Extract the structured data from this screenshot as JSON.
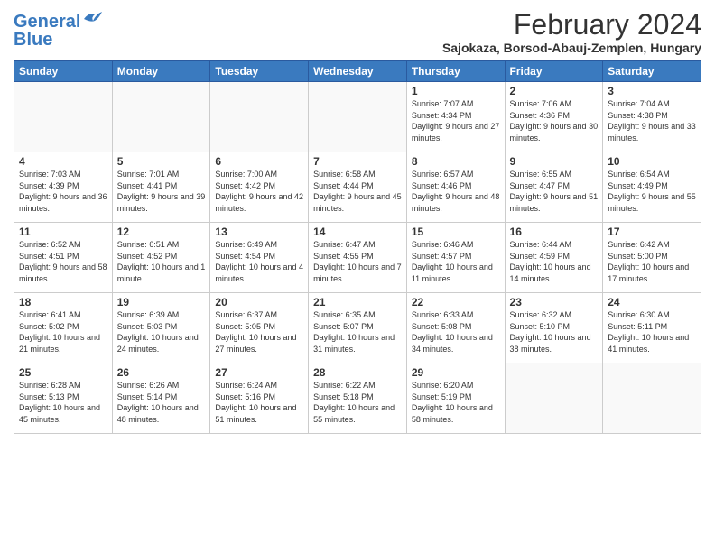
{
  "logo": {
    "line1": "General",
    "line2": "Blue"
  },
  "title": "February 2024",
  "subtitle": "Sajokaza, Borsod-Abauj-Zemplen, Hungary",
  "headers": [
    "Sunday",
    "Monday",
    "Tuesday",
    "Wednesday",
    "Thursday",
    "Friday",
    "Saturday"
  ],
  "weeks": [
    [
      {
        "day": "",
        "info": ""
      },
      {
        "day": "",
        "info": ""
      },
      {
        "day": "",
        "info": ""
      },
      {
        "day": "",
        "info": ""
      },
      {
        "day": "1",
        "info": "Sunrise: 7:07 AM\nSunset: 4:34 PM\nDaylight: 9 hours and 27 minutes."
      },
      {
        "day": "2",
        "info": "Sunrise: 7:06 AM\nSunset: 4:36 PM\nDaylight: 9 hours and 30 minutes."
      },
      {
        "day": "3",
        "info": "Sunrise: 7:04 AM\nSunset: 4:38 PM\nDaylight: 9 hours and 33 minutes."
      }
    ],
    [
      {
        "day": "4",
        "info": "Sunrise: 7:03 AM\nSunset: 4:39 PM\nDaylight: 9 hours and 36 minutes."
      },
      {
        "day": "5",
        "info": "Sunrise: 7:01 AM\nSunset: 4:41 PM\nDaylight: 9 hours and 39 minutes."
      },
      {
        "day": "6",
        "info": "Sunrise: 7:00 AM\nSunset: 4:42 PM\nDaylight: 9 hours and 42 minutes."
      },
      {
        "day": "7",
        "info": "Sunrise: 6:58 AM\nSunset: 4:44 PM\nDaylight: 9 hours and 45 minutes."
      },
      {
        "day": "8",
        "info": "Sunrise: 6:57 AM\nSunset: 4:46 PM\nDaylight: 9 hours and 48 minutes."
      },
      {
        "day": "9",
        "info": "Sunrise: 6:55 AM\nSunset: 4:47 PM\nDaylight: 9 hours and 51 minutes."
      },
      {
        "day": "10",
        "info": "Sunrise: 6:54 AM\nSunset: 4:49 PM\nDaylight: 9 hours and 55 minutes."
      }
    ],
    [
      {
        "day": "11",
        "info": "Sunrise: 6:52 AM\nSunset: 4:51 PM\nDaylight: 9 hours and 58 minutes."
      },
      {
        "day": "12",
        "info": "Sunrise: 6:51 AM\nSunset: 4:52 PM\nDaylight: 10 hours and 1 minute."
      },
      {
        "day": "13",
        "info": "Sunrise: 6:49 AM\nSunset: 4:54 PM\nDaylight: 10 hours and 4 minutes."
      },
      {
        "day": "14",
        "info": "Sunrise: 6:47 AM\nSunset: 4:55 PM\nDaylight: 10 hours and 7 minutes."
      },
      {
        "day": "15",
        "info": "Sunrise: 6:46 AM\nSunset: 4:57 PM\nDaylight: 10 hours and 11 minutes."
      },
      {
        "day": "16",
        "info": "Sunrise: 6:44 AM\nSunset: 4:59 PM\nDaylight: 10 hours and 14 minutes."
      },
      {
        "day": "17",
        "info": "Sunrise: 6:42 AM\nSunset: 5:00 PM\nDaylight: 10 hours and 17 minutes."
      }
    ],
    [
      {
        "day": "18",
        "info": "Sunrise: 6:41 AM\nSunset: 5:02 PM\nDaylight: 10 hours and 21 minutes."
      },
      {
        "day": "19",
        "info": "Sunrise: 6:39 AM\nSunset: 5:03 PM\nDaylight: 10 hours and 24 minutes."
      },
      {
        "day": "20",
        "info": "Sunrise: 6:37 AM\nSunset: 5:05 PM\nDaylight: 10 hours and 27 minutes."
      },
      {
        "day": "21",
        "info": "Sunrise: 6:35 AM\nSunset: 5:07 PM\nDaylight: 10 hours and 31 minutes."
      },
      {
        "day": "22",
        "info": "Sunrise: 6:33 AM\nSunset: 5:08 PM\nDaylight: 10 hours and 34 minutes."
      },
      {
        "day": "23",
        "info": "Sunrise: 6:32 AM\nSunset: 5:10 PM\nDaylight: 10 hours and 38 minutes."
      },
      {
        "day": "24",
        "info": "Sunrise: 6:30 AM\nSunset: 5:11 PM\nDaylight: 10 hours and 41 minutes."
      }
    ],
    [
      {
        "day": "25",
        "info": "Sunrise: 6:28 AM\nSunset: 5:13 PM\nDaylight: 10 hours and 45 minutes."
      },
      {
        "day": "26",
        "info": "Sunrise: 6:26 AM\nSunset: 5:14 PM\nDaylight: 10 hours and 48 minutes."
      },
      {
        "day": "27",
        "info": "Sunrise: 6:24 AM\nSunset: 5:16 PM\nDaylight: 10 hours and 51 minutes."
      },
      {
        "day": "28",
        "info": "Sunrise: 6:22 AM\nSunset: 5:18 PM\nDaylight: 10 hours and 55 minutes."
      },
      {
        "day": "29",
        "info": "Sunrise: 6:20 AM\nSunset: 5:19 PM\nDaylight: 10 hours and 58 minutes."
      },
      {
        "day": "",
        "info": ""
      },
      {
        "day": "",
        "info": ""
      }
    ]
  ]
}
